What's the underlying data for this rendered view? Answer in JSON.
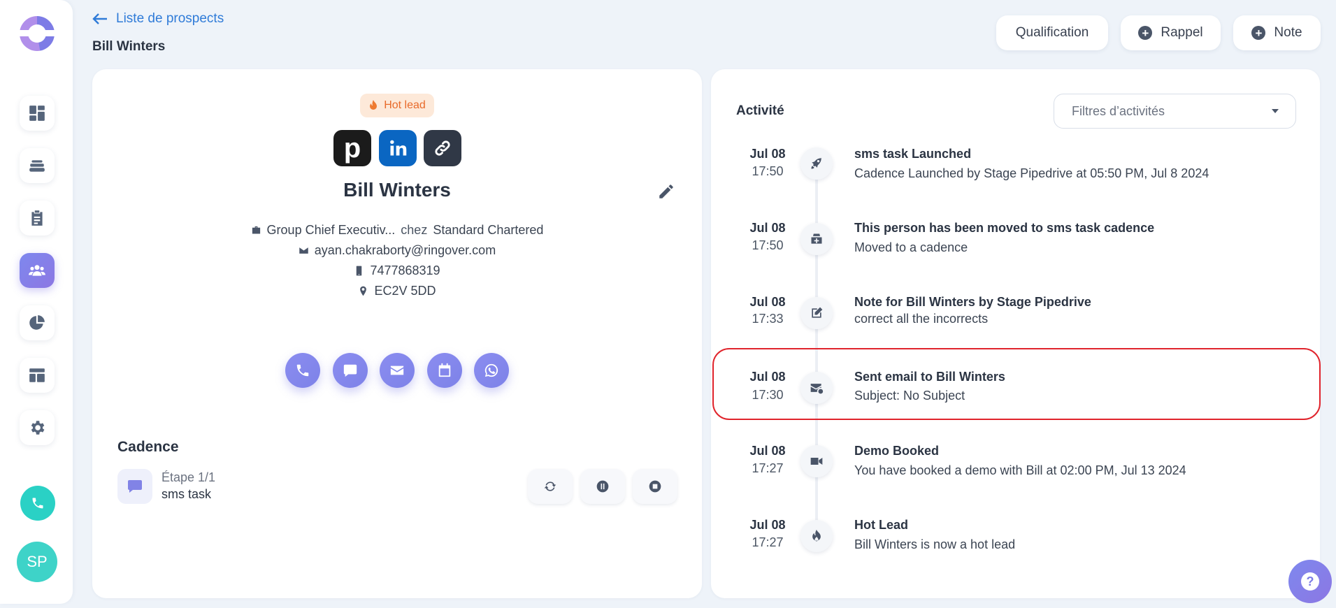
{
  "header": {
    "back_label": "Liste de prospects",
    "page_title": "Bill Winters",
    "buttons": {
      "qualification": "Qualification",
      "rappel": "Rappel",
      "note": "Note"
    }
  },
  "sidebar": {
    "items": [
      {
        "icon": "dashboard-icon"
      },
      {
        "icon": "stack-icon"
      },
      {
        "icon": "clipboard-icon"
      },
      {
        "icon": "people-icon",
        "active": true
      },
      {
        "icon": "pie-chart-icon"
      },
      {
        "icon": "template-icon"
      },
      {
        "icon": "gear-icon"
      }
    ],
    "avatar_initials": "SP"
  },
  "contact": {
    "badge": "Hot lead",
    "name": "Bill Winters",
    "job_title": "Group Chief Executiv...",
    "company_prefix": "chez",
    "company": "Standard Chartered",
    "email": "ayan.chakraborty@ringover.com",
    "phone": "7477868319",
    "postcode": "EC2V 5DD",
    "social_pipedrive": "p"
  },
  "cadence": {
    "title": "Cadence",
    "step": "Étape 1/1",
    "task": "sms task"
  },
  "activity": {
    "title": "Activité",
    "filter_placeholder": "Filtres d’activités",
    "items": [
      {
        "date": "Jul 08",
        "time": "17:50",
        "title": "sms task Launched",
        "subtitle": "Cadence Launched by Stage Pipedrive at 05:50 PM, Jul 8 2024",
        "icon": "rocket-icon"
      },
      {
        "date": "Jul 08",
        "time": "17:50",
        "title": "This person has been moved to sms task cadence",
        "subtitle": "Moved to a cadence",
        "icon": "inbox-plus-icon"
      },
      {
        "date": "Jul 08",
        "time": "17:33",
        "title": "Note for Bill Winters by Stage Pipedrive",
        "subtitle": "correct all the incorrects",
        "icon": "edit-note-icon"
      },
      {
        "date": "Jul 08",
        "time": "17:30",
        "title": "Sent email to Bill Winters",
        "subtitle": "Subject: No Subject",
        "icon": "mail-sent-icon"
      },
      {
        "date": "Jul 08",
        "time": "17:27",
        "title": "Demo Booked",
        "subtitle": "You have booked a demo with Bill at 02:00 PM, Jul 13 2024",
        "icon": "video-icon"
      },
      {
        "date": "Jul 08",
        "time": "17:27",
        "title": "Hot Lead",
        "subtitle": "Bill Winters is now a hot lead",
        "icon": "flame-icon"
      }
    ]
  }
}
